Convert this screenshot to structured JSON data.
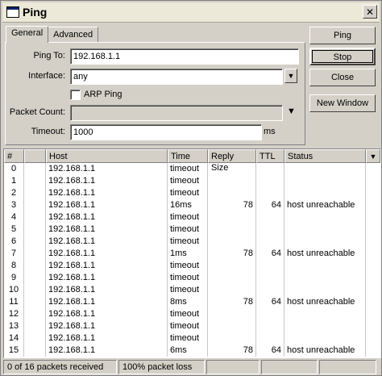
{
  "window": {
    "title": "Ping",
    "close_glyph": "✕"
  },
  "tabs": [
    {
      "label": "General"
    },
    {
      "label": "Advanced"
    }
  ],
  "form": {
    "ping_to_label": "Ping To:",
    "ping_to_value": "192.168.1.1",
    "interface_label": "Interface:",
    "interface_value": "any",
    "arp_label": "ARP Ping",
    "arp_checked": false,
    "packet_count_label": "Packet Count:",
    "packet_count_value": "",
    "timeout_label": "Timeout:",
    "timeout_value": "1000",
    "timeout_unit": "ms"
  },
  "buttons": {
    "ping": "Ping",
    "stop": "Stop",
    "close": "Close",
    "new_window": "New Window"
  },
  "table": {
    "columns": [
      "#",
      "",
      "Host",
      "Time",
      "Reply Size",
      "TTL",
      "Status"
    ],
    "rows": [
      {
        "n": "0",
        "host": "192.168.1.1",
        "time": "timeout",
        "size": "",
        "ttl": "",
        "status": ""
      },
      {
        "n": "1",
        "host": "192.168.1.1",
        "time": "timeout",
        "size": "",
        "ttl": "",
        "status": ""
      },
      {
        "n": "2",
        "host": "192.168.1.1",
        "time": "timeout",
        "size": "",
        "ttl": "",
        "status": ""
      },
      {
        "n": "3",
        "host": "192.168.1.1",
        "time": "16ms",
        "size": "78",
        "ttl": "64",
        "status": "host unreachable"
      },
      {
        "n": "4",
        "host": "192.168.1.1",
        "time": "timeout",
        "size": "",
        "ttl": "",
        "status": ""
      },
      {
        "n": "5",
        "host": "192.168.1.1",
        "time": "timeout",
        "size": "",
        "ttl": "",
        "status": ""
      },
      {
        "n": "6",
        "host": "192.168.1.1",
        "time": "timeout",
        "size": "",
        "ttl": "",
        "status": ""
      },
      {
        "n": "7",
        "host": "192.168.1.1",
        "time": "1ms",
        "size": "78",
        "ttl": "64",
        "status": "host unreachable"
      },
      {
        "n": "8",
        "host": "192.168.1.1",
        "time": "timeout",
        "size": "",
        "ttl": "",
        "status": ""
      },
      {
        "n": "9",
        "host": "192.168.1.1",
        "time": "timeout",
        "size": "",
        "ttl": "",
        "status": ""
      },
      {
        "n": "10",
        "host": "192.168.1.1",
        "time": "timeout",
        "size": "",
        "ttl": "",
        "status": ""
      },
      {
        "n": "11",
        "host": "192.168.1.1",
        "time": "8ms",
        "size": "78",
        "ttl": "64",
        "status": "host unreachable"
      },
      {
        "n": "12",
        "host": "192.168.1.1",
        "time": "timeout",
        "size": "",
        "ttl": "",
        "status": ""
      },
      {
        "n": "13",
        "host": "192.168.1.1",
        "time": "timeout",
        "size": "",
        "ttl": "",
        "status": ""
      },
      {
        "n": "14",
        "host": "192.168.1.1",
        "time": "timeout",
        "size": "",
        "ttl": "",
        "status": ""
      },
      {
        "n": "15",
        "host": "192.168.1.1",
        "time": "6ms",
        "size": "78",
        "ttl": "64",
        "status": "host unreachable"
      }
    ]
  },
  "statusbar": {
    "received": "0 of 16 packets received",
    "loss": "100% packet loss"
  },
  "icons": {
    "window_icon": "window-icon",
    "dropdown": "down-arrow-icon",
    "column_menu": "down-triangle-icon"
  }
}
